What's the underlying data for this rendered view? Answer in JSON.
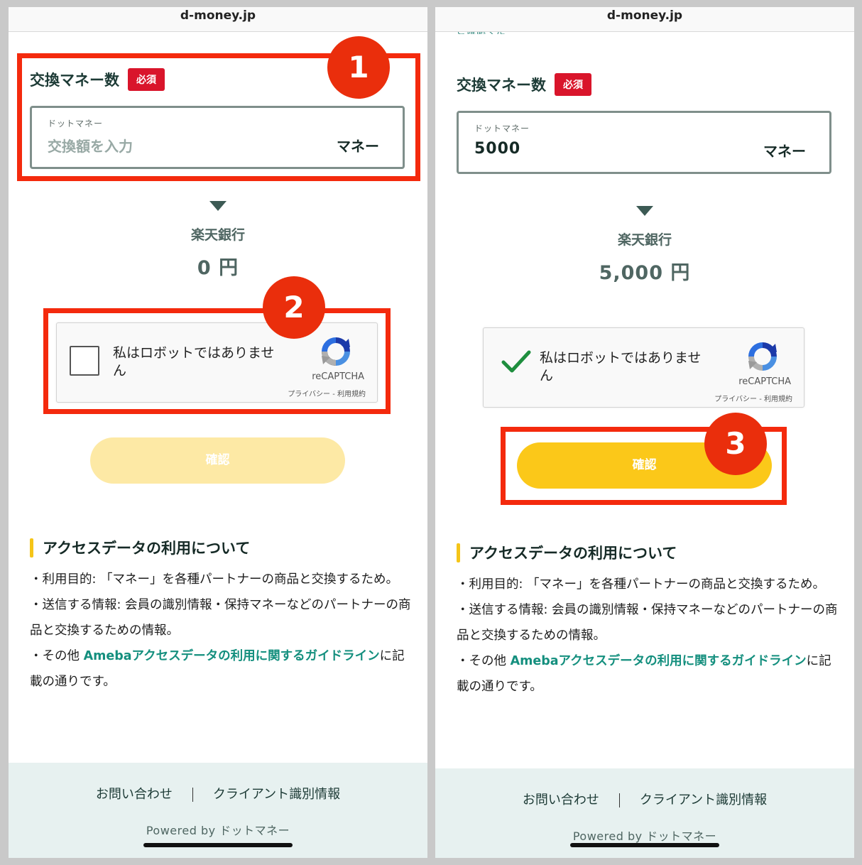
{
  "left": {
    "url": "d-money.jp",
    "exchange_title": "交換マネー数",
    "required_badge": "必須",
    "money_caption": "ドットマネー",
    "amount_placeholder": "交換額を入力",
    "unit": "マネー",
    "bank_name": "楽天銀行",
    "bank_amount": "0 円",
    "captcha": {
      "label": "私はロボットではありません",
      "brand": "reCAPTCHA",
      "links": "プライバシー - 利用規約",
      "checked": false
    },
    "confirm_label": "確認",
    "confirm_enabled": false,
    "info_heading": "アクセスデータの利用について",
    "info_line1": "・利用目的: 「マネー」を各種パートナーの商品と交換するため。",
    "info_line2": "・送信する情報: 会員の識別情報・保持マネーなどのパートナーの商品と交換するための情報。",
    "info_line3_prefix": "・その他 ",
    "info_line3_link": "Amebaアクセスデータの利用に関するガイドライン",
    "info_line3_suffix": "に記載の通りです。",
    "footer_contact": "お問い合わせ",
    "footer_client_info": "クライアント識別情報",
    "powered_by": "Powered by ドットマネー",
    "step_marker_1": "1",
    "step_marker_2": "2"
  },
  "right": {
    "url": "d-money.jp",
    "exchange_title": "交換マネー数",
    "required_badge": "必須",
    "money_caption": "ドットマネー",
    "amount_value": "5000",
    "unit": "マネー",
    "bank_name": "楽天銀行",
    "bank_amount": "5,000 円",
    "captcha": {
      "label": "私はロボットではありません",
      "brand": "reCAPTCHA",
      "links": "プライバシー - 利用規約",
      "checked": true
    },
    "confirm_label": "確認",
    "confirm_enabled": true,
    "info_heading": "アクセスデータの利用について",
    "info_line1": "・利用目的: 「マネー」を各種パートナーの商品と交換するため。",
    "info_line2": "・送信する情報: 会員の識別情報・保持マネーなどのパートナーの商品と交換するための情報。",
    "info_line3_prefix": "・その他 ",
    "info_line3_link": "Amebaアクセスデータの利用に関するガイドライン",
    "info_line3_suffix": "に記載の通りです。",
    "footer_contact": "お問い合わせ",
    "footer_client_info": "クライアント識別情報",
    "powered_by": "Powered by ドットマネー",
    "step_marker_3": "3"
  },
  "colors": {
    "highlight": "#f42a0d",
    "step_marker": "#ea2e0c",
    "required_badge": "#d9152b",
    "confirm_enabled": "#fbc819",
    "confirm_disabled": "#fde9a5",
    "link": "#148f7e",
    "checkmark": "#1e8e3e"
  },
  "icons": [
    "triangle-down-icon",
    "recaptcha-logo-icon",
    "checkmark-icon",
    "checkbox-icon"
  ]
}
